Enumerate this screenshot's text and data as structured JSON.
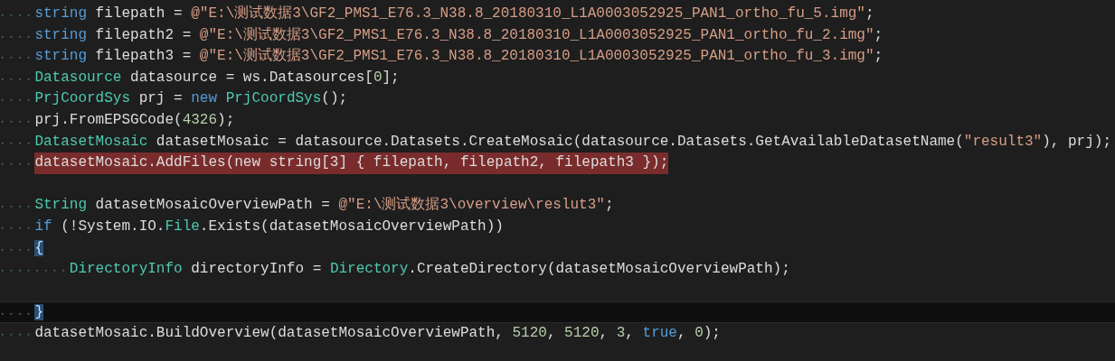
{
  "editor": {
    "lines": [
      {
        "kind": "code",
        "tokens": [
          {
            "text": "string",
            "kind": "keyword"
          },
          {
            "text": " filepath = ",
            "kind": "plain"
          },
          {
            "text": "@\"E:\\测试数据3\\GF2_PMS1_E76.3_N38.8_20180310_L1A0003052925_PAN1_ortho_fu_5.img\"",
            "kind": "string"
          },
          {
            "text": ";",
            "kind": "plain"
          }
        ]
      },
      {
        "kind": "code",
        "tokens": [
          {
            "text": "string",
            "kind": "keyword"
          },
          {
            "text": " filepath2 = ",
            "kind": "plain"
          },
          {
            "text": "@\"E:\\测试数据3\\GF2_PMS1_E76.3_N38.8_20180310_L1A0003052925_PAN1_ortho_fu_2.img\"",
            "kind": "string"
          },
          {
            "text": ";",
            "kind": "plain"
          }
        ]
      },
      {
        "kind": "code",
        "tokens": [
          {
            "text": "string",
            "kind": "keyword"
          },
          {
            "text": " filepath3 = ",
            "kind": "plain"
          },
          {
            "text": "@\"E:\\测试数据3\\GF2_PMS1_E76.3_N38.8_20180310_L1A0003052925_PAN1_ortho_fu_3.img\"",
            "kind": "string"
          },
          {
            "text": ";",
            "kind": "plain"
          }
        ]
      },
      {
        "kind": "code",
        "tokens": [
          {
            "text": "Datasource",
            "kind": "type"
          },
          {
            "text": " datasource = ws.Datasources[",
            "kind": "plain"
          },
          {
            "text": "0",
            "kind": "number"
          },
          {
            "text": "];",
            "kind": "plain"
          }
        ]
      },
      {
        "kind": "code",
        "tokens": [
          {
            "text": "PrjCoordSys",
            "kind": "type"
          },
          {
            "text": " prj = ",
            "kind": "plain"
          },
          {
            "text": "new",
            "kind": "keyword"
          },
          {
            "text": " PrjCoordSys",
            "kind": "type"
          },
          {
            "text": "();",
            "kind": "plain"
          }
        ]
      },
      {
        "kind": "code",
        "tokens": [
          {
            "text": "prj.FromEPSGCode(",
            "kind": "plain"
          },
          {
            "text": "4326",
            "kind": "number"
          },
          {
            "text": ");",
            "kind": "plain"
          }
        ]
      },
      {
        "kind": "code",
        "tokens": [
          {
            "text": "DatasetMosaic",
            "kind": "type"
          },
          {
            "text": " datasetMosaic = datasource.Datasets.CreateMosaic(datasource.Datasets.GetAvailableDatasetName(",
            "kind": "plain"
          },
          {
            "text": "\"result3\"",
            "kind": "string"
          },
          {
            "text": "), prj);",
            "kind": "plain"
          }
        ]
      },
      {
        "kind": "code",
        "highlighted": true,
        "tokens": [
          {
            "text": "datasetMosaic.AddFiles(new string[3] { filepath, filepath2, filepath3 });",
            "kind": "plain"
          }
        ]
      },
      {
        "kind": "blank"
      },
      {
        "kind": "code",
        "tokens": [
          {
            "text": "String",
            "kind": "type"
          },
          {
            "text": " datasetMosaicOverviewPath = ",
            "kind": "plain"
          },
          {
            "text": "@\"E:\\测试数据3\\overview\\reslut3\"",
            "kind": "string"
          },
          {
            "text": ";",
            "kind": "plain"
          }
        ]
      },
      {
        "kind": "code",
        "tokens": [
          {
            "text": "if",
            "kind": "keyword"
          },
          {
            "text": " (!System.IO.",
            "kind": "plain"
          },
          {
            "text": "File",
            "kind": "type"
          },
          {
            "text": ".Exists(datasetMosaicOverviewPath))",
            "kind": "plain"
          }
        ]
      },
      {
        "kind": "code",
        "brace_matched": true,
        "tokens": [
          {
            "text": "{",
            "kind": "plain"
          }
        ],
        "children": [
          {
            "kind": "code",
            "tokens": [
              {
                "text": "DirectoryInfo",
                "kind": "type"
              },
              {
                "text": " directoryInfo = ",
                "kind": "plain"
              },
              {
                "text": "Directory",
                "kind": "type"
              },
              {
                "text": ".CreateDirectory(datasetMosaicOverviewPath);",
                "kind": "plain"
              }
            ]
          },
          {
            "kind": "blank"
          }
        ]
      },
      {
        "kind": "code",
        "current": true,
        "brace_matched": true,
        "tokens": [
          {
            "text": "}",
            "kind": "plain"
          }
        ]
      },
      {
        "kind": "code",
        "tokens": [
          {
            "text": "datasetMosaic.BuildOverview(datasetMosaicOverviewPath, ",
            "kind": "plain"
          },
          {
            "text": "5120",
            "kind": "number"
          },
          {
            "text": ", ",
            "kind": "plain"
          },
          {
            "text": "5120",
            "kind": "number"
          },
          {
            "text": ", ",
            "kind": "plain"
          },
          {
            "text": "3",
            "kind": "number"
          },
          {
            "text": ", ",
            "kind": "plain"
          },
          {
            "text": "true",
            "kind": "keyword"
          },
          {
            "text": ", ",
            "kind": "plain"
          },
          {
            "text": "0",
            "kind": "number"
          },
          {
            "text": ");",
            "kind": "plain"
          }
        ]
      }
    ]
  }
}
